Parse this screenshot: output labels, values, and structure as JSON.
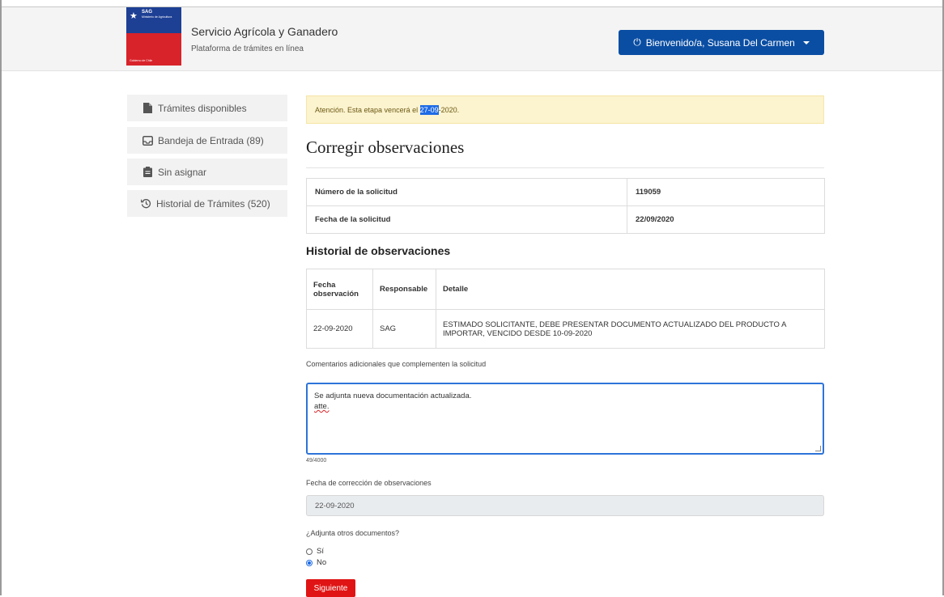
{
  "header": {
    "logo": {
      "org": "SAG",
      "ministry": "Ministerio de Agricultura",
      "government": "Gobierno de Chile"
    },
    "title": "Servicio Agrícola y Ganadero",
    "subtitle": "Plataforma de trámites en línea",
    "user_button": "Bienvenido/a, Susana Del Carmen"
  },
  "sidebar": {
    "items": [
      {
        "label": "Trámites disponibles",
        "icon": "file-icon"
      },
      {
        "label": "Bandeja de Entrada (89)",
        "icon": "inbox-icon"
      },
      {
        "label": "Sin asignar",
        "icon": "clipboard-icon"
      },
      {
        "label": "Historial de Trámites (520)",
        "icon": "history-icon"
      }
    ]
  },
  "alert": {
    "prefix": "Atención. Esta etapa vencerá el ",
    "highlight": "27-09",
    "suffix": "-2020."
  },
  "page_title": "Corregir observaciones",
  "solicitud": {
    "rows": [
      {
        "label": "Número de la solicitud",
        "value": "119059"
      },
      {
        "label": "Fecha de la solicitud",
        "value": "22/09/2020"
      }
    ]
  },
  "historial": {
    "title": "Historial de observaciones",
    "headers": [
      "Fecha observación",
      "Responsable",
      "Detalle"
    ],
    "rows": [
      {
        "fecha": "22-09-2020",
        "responsable": "SAG",
        "detalle": "ESTIMADO SOLICITANTE, DEBE PRESENTAR DOCUMENTO ACTUALIZADO DEL PRODUCTO A IMPORTAR, VENCIDO DESDE 10-09-2020"
      }
    ]
  },
  "comentarios": {
    "label": "Comentarios adicionales que complementen la solicitud",
    "line1": "Se adjunta nueva documentación actualizada.",
    "line2": "atte.",
    "counter": "49/4000"
  },
  "fecha_correccion": {
    "label": "Fecha de corrección de observaciones",
    "value": "22-09-2020"
  },
  "adjunta": {
    "question": "¿Adjunta otros documentos?",
    "options": [
      {
        "label": "Sí",
        "selected": false
      },
      {
        "label": "No",
        "selected": true
      }
    ]
  },
  "next_button": "Siguiente",
  "colors": {
    "primary": "#0a4ea3",
    "danger": "#e01414",
    "alert_bg": "#fcf3cf"
  }
}
